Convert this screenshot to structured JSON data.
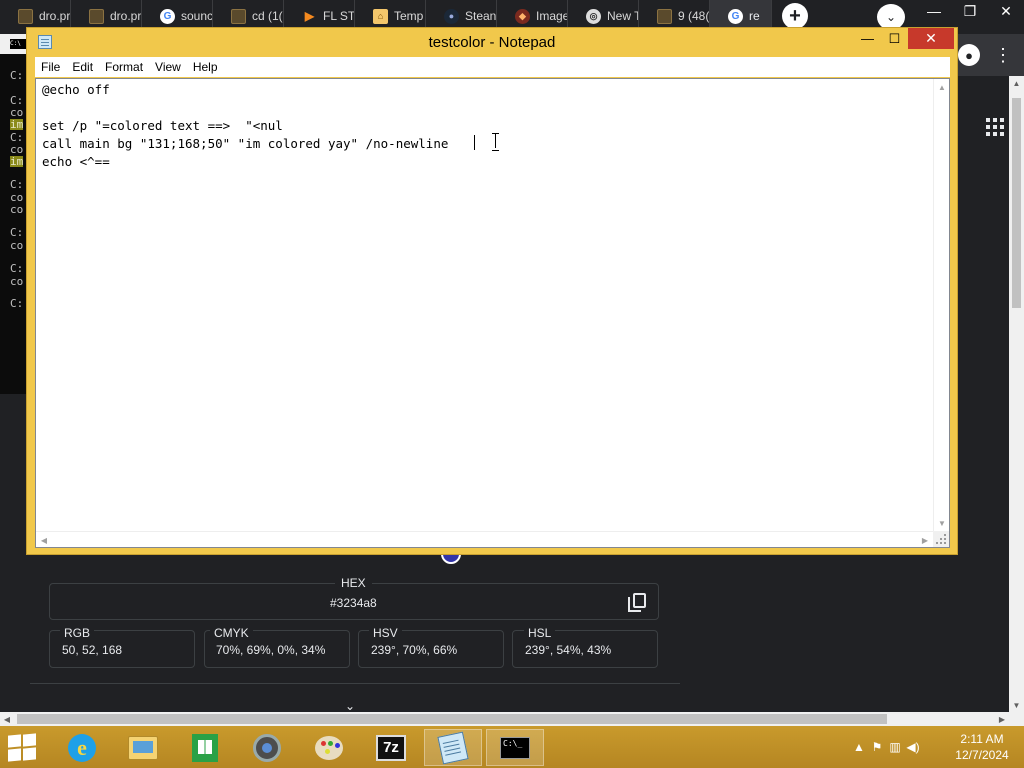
{
  "browser": {
    "tabs": [
      {
        "title": "dro.pr",
        "icon": "folder-icon"
      },
      {
        "title": "dro.pr",
        "icon": "folder-icon"
      },
      {
        "title": "sounc",
        "icon": "google-icon"
      },
      {
        "title": "cd (1(",
        "icon": "folder-icon"
      },
      {
        "title": "FL STI",
        "icon": "fl-studio-icon"
      },
      {
        "title": "Temp",
        "icon": "home-icon"
      },
      {
        "title": "Stean",
        "icon": "steam-icon"
      },
      {
        "title": "Image",
        "icon": "image-icon"
      },
      {
        "title": "New T",
        "icon": "chrome-icon"
      },
      {
        "title": "9 (48(",
        "icon": "folder-icon"
      },
      {
        "title": "re",
        "icon": "google-icon"
      }
    ],
    "new_tab_glyph": "+",
    "dropdown_glyph": "⌄",
    "window_controls": {
      "minimize": "—",
      "restore": "❐",
      "close": "✕"
    }
  },
  "console": {
    "lines": [
      "C:",
      "C:",
      "co",
      "im",
      "C:",
      "co",
      "im",
      "C:",
      "co",
      "co",
      "C:",
      "co",
      "C:",
      "co",
      "C:"
    ],
    "mini_label": "C:\\"
  },
  "notepad": {
    "title": "testcolor - Notepad",
    "menu": [
      "File",
      "Edit",
      "Format",
      "View",
      "Help"
    ],
    "window_controls": {
      "minimize": "—",
      "maximize": "☐",
      "close": "✕"
    },
    "content": "@echo off\n\nset /p \"=colored text ==>  \"<nul\ncall main bg \"131;168;50\" \"im colored yay\" /no-newline\necho <^=="
  },
  "color_picker": {
    "swatch_color": "#3234a8",
    "hex_label": "HEX",
    "hex_value": "#3234a8",
    "fields": [
      {
        "label": "RGB",
        "value": "50, 52, 168"
      },
      {
        "label": "CMYK",
        "value": "70%, 69%, 0%, 34%"
      },
      {
        "label": "HSV",
        "value": "239°, 70%, 66%"
      },
      {
        "label": "HSL",
        "value": "239°, 54%, 43%"
      }
    ]
  },
  "taskbar": {
    "apps": [
      "internet-explorer",
      "file-explorer",
      "store",
      "chrome",
      "paint",
      "7-zip",
      "notepad",
      "command-prompt"
    ],
    "sevenzip_label": "7z",
    "cmd_label": "C:\\_",
    "clock": {
      "time": "2:11 AM",
      "date": "12/7/2024"
    }
  },
  "colors": {
    "taskbar": "#c99a2c",
    "notepad_frame": "#f1c84b",
    "close_button": "#c7392b",
    "browser_bg": "#202124"
  }
}
